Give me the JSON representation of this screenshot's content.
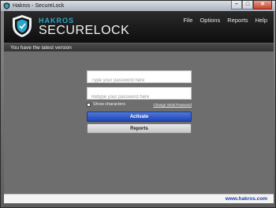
{
  "window": {
    "title": "Hakros - SecureLock"
  },
  "window_controls": {
    "minimize": "–",
    "maximize": "□",
    "close": "✕"
  },
  "brand": {
    "top": "HAKROS",
    "main": "SECURELOCK"
  },
  "menu": [
    {
      "label": "File"
    },
    {
      "label": "Options"
    },
    {
      "label": "Reports"
    },
    {
      "label": "Help"
    }
  ],
  "status": {
    "text": "You have the latest version"
  },
  "form": {
    "password_placeholder": "Type your password here",
    "retype_placeholder": "Retype your password here",
    "show_characters_label": "Show characters",
    "show_characters_checked": false,
    "change_password_link": "Change Initial Password",
    "activate_label": "Activate",
    "reports_label": "Reports"
  },
  "footer": {
    "link": "www.hakros.com"
  },
  "colors": {
    "brand_accent": "#2aa6c8",
    "activate_button": "#2f55c6",
    "footer_link": "#1b3fa6"
  }
}
